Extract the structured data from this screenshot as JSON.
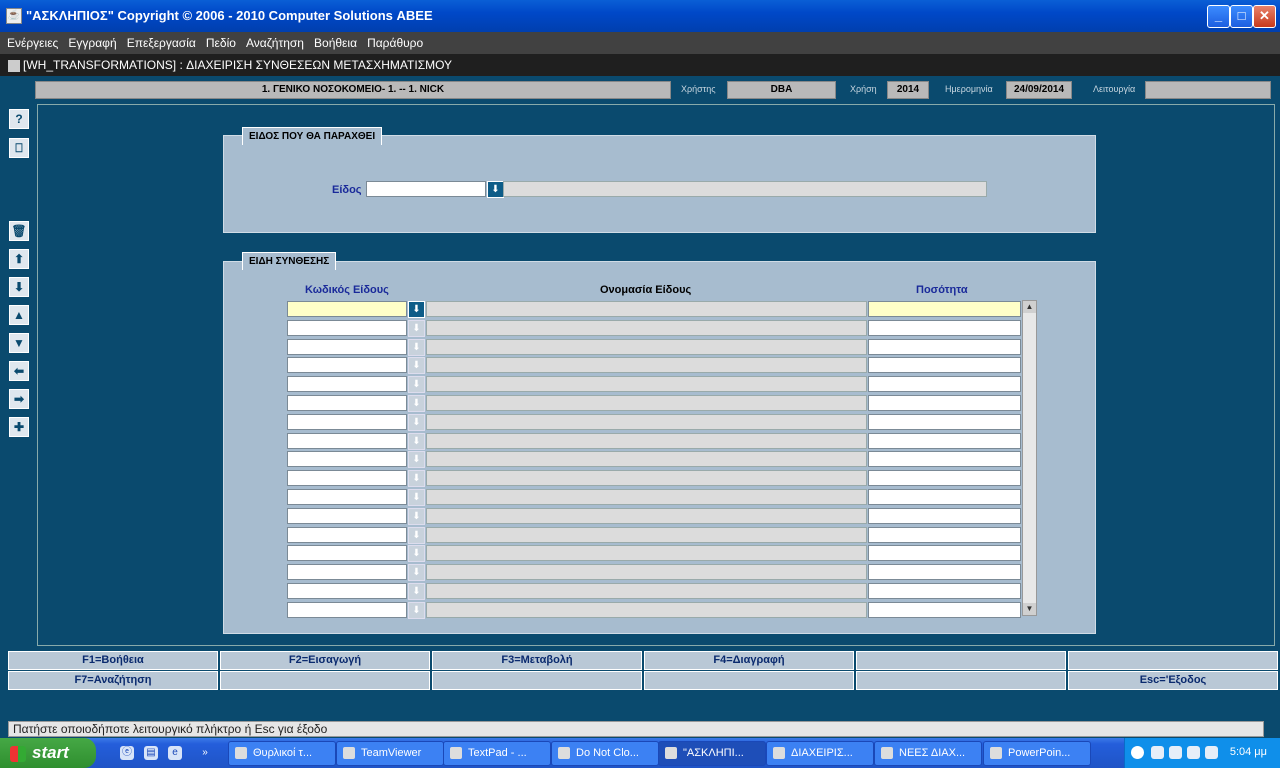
{
  "window": {
    "title": "\"ΑΣΚΛΗΠΙΟΣ\" Copyright © 2006 - 2010 Computer Solutions ΑΒΕΕ",
    "controls": [
      "_",
      "□",
      "✕"
    ]
  },
  "menu": [
    "Ενέργειες",
    "Εγγραφή",
    "Επεξεργασία",
    "Πεδίο",
    "Αναζήτηση",
    "Βοήθεια",
    "Παράθυρο"
  ],
  "form": {
    "title": "[WH_TRANSFORMATIONS]   :  ΔΙΑΧΕΙΡΙΣΗ ΣΥΝΘΕΣΕΩΝ ΜΕΤΑΣΧΗΜΑΤΙΣΜΟΥ"
  },
  "info": {
    "hospital": "1. ΓΕΝΙΚΟ ΝΟΣΟΚΟΜΕΙΟ- 1. -- 1. NICK",
    "user_label": "Χρήστης",
    "user": "DBA",
    "year_label": "Χρήση",
    "year": "2014",
    "date_label": "Ημερομηνία",
    "date": "24/09/2014",
    "function_label": "Λειτουργία",
    "function": ""
  },
  "toolbar": [
    "?",
    "⎕",
    "🗑",
    "⬆",
    "⬇",
    "▲",
    "▼",
    "⬅",
    "➡",
    "✚"
  ],
  "section1": {
    "title": "ΕΙΔΟΣ ΠΟΥ ΘΑ ΠΑΡΑΧΘΕΙ",
    "field_label": "Είδος",
    "field_value": "",
    "field_desc": ""
  },
  "section2": {
    "title": "ΕΙΔΗ ΣΥΝΘΕΣΗΣ",
    "col_code": "Κωδικός Είδους",
    "col_name": "Ονομασία Είδους",
    "col_qty": "Ποσότητα",
    "rows": 17
  },
  "function_keys": [
    "F1=Βοήθεια",
    "F2=Εισαγωγή",
    "F3=Μεταβολή",
    "F4=Διαγραφή",
    "",
    "",
    "F7=Αναζήτηση",
    "",
    "",
    "",
    "",
    "Esc='Εξοδος"
  ],
  "status": "Πατήστε οποιοδήποτε λειτουργικό πλήκτρο ή Esc για έξοδο",
  "taskbar": {
    "start": "start",
    "tasks": [
      "Θυρλικοί τ...",
      "TeamViewer",
      "TextPad - ...",
      "Do Not Clo...",
      "\"ΑΣΚΛΗΠΙ...",
      "ΔΙΑΧΕΙΡΙΣ...",
      "ΝΕΕΣ ΔΙΑΧ...",
      "PowerPoin..."
    ],
    "clock": "5:04 μμ"
  }
}
